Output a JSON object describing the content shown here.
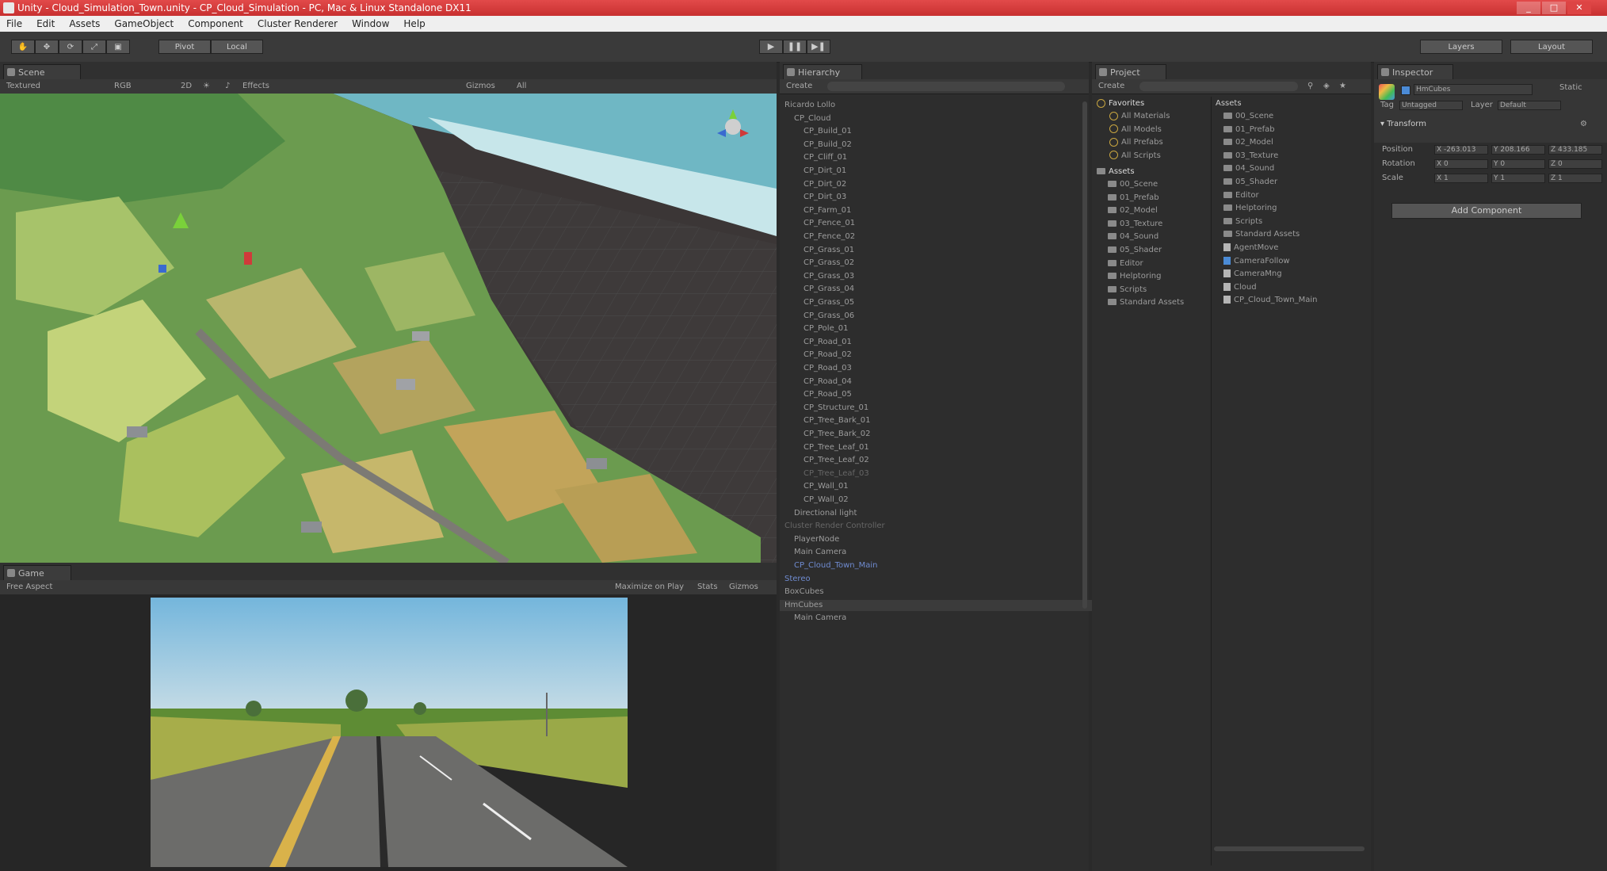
{
  "window": {
    "title": "Unity - Cloud_Simulation_Town.unity - CP_Cloud_Simulation - PC, Mac & Linux Standalone DX11"
  },
  "menubar": [
    "File",
    "Edit",
    "Assets",
    "GameObject",
    "Component",
    "Cluster Renderer",
    "Window",
    "Help"
  ],
  "toolbar": {
    "pivot": "Pivot",
    "space": "Local",
    "layers": "Layers",
    "layout": "Layout"
  },
  "scene": {
    "tab": "Scene",
    "shading": "Textured",
    "mode": "RGB",
    "twod": "2D",
    "effects": "Effects",
    "gizmos": "Gizmos",
    "search": "All"
  },
  "game": {
    "tab": "Game",
    "aspect": "Free Aspect",
    "maximize": "Maximize on Play",
    "stats": "Stats",
    "gizmos": "Gizmos"
  },
  "hierarchy": {
    "tab": "Hierarchy",
    "create": "Create",
    "items": [
      {
        "label": "Ricardo Lollo",
        "indent": 0,
        "style": ""
      },
      {
        "label": "CP_Cloud",
        "indent": 1,
        "style": ""
      },
      {
        "label": "CP_Build_01",
        "indent": 2,
        "style": ""
      },
      {
        "label": "CP_Build_02",
        "indent": 2,
        "style": ""
      },
      {
        "label": "CP_Cliff_01",
        "indent": 2,
        "style": ""
      },
      {
        "label": "CP_Dirt_01",
        "indent": 2,
        "style": ""
      },
      {
        "label": "CP_Dirt_02",
        "indent": 2,
        "style": ""
      },
      {
        "label": "CP_Dirt_03",
        "indent": 2,
        "style": ""
      },
      {
        "label": "CP_Farm_01",
        "indent": 2,
        "style": ""
      },
      {
        "label": "CP_Fence_01",
        "indent": 2,
        "style": ""
      },
      {
        "label": "CP_Fence_02",
        "indent": 2,
        "style": ""
      },
      {
        "label": "CP_Grass_01",
        "indent": 2,
        "style": ""
      },
      {
        "label": "CP_Grass_02",
        "indent": 2,
        "style": ""
      },
      {
        "label": "CP_Grass_03",
        "indent": 2,
        "style": ""
      },
      {
        "label": "CP_Grass_04",
        "indent": 2,
        "style": ""
      },
      {
        "label": "CP_Grass_05",
        "indent": 2,
        "style": ""
      },
      {
        "label": "CP_Grass_06",
        "indent": 2,
        "style": ""
      },
      {
        "label": "CP_Pole_01",
        "indent": 2,
        "style": ""
      },
      {
        "label": "CP_Road_01",
        "indent": 2,
        "style": ""
      },
      {
        "label": "CP_Road_02",
        "indent": 2,
        "style": ""
      },
      {
        "label": "CP_Road_03",
        "indent": 2,
        "style": ""
      },
      {
        "label": "CP_Road_04",
        "indent": 2,
        "style": ""
      },
      {
        "label": "CP_Road_05",
        "indent": 2,
        "style": ""
      },
      {
        "label": "CP_Structure_01",
        "indent": 2,
        "style": ""
      },
      {
        "label": "CP_Tree_Bark_01",
        "indent": 2,
        "style": ""
      },
      {
        "label": "CP_Tree_Bark_02",
        "indent": 2,
        "style": ""
      },
      {
        "label": "CP_Tree_Leaf_01",
        "indent": 2,
        "style": ""
      },
      {
        "label": "CP_Tree_Leaf_02",
        "indent": 2,
        "style": ""
      },
      {
        "label": "CP_Tree_Leaf_03",
        "indent": 2,
        "style": "dim"
      },
      {
        "label": "CP_Wall_01",
        "indent": 2,
        "style": ""
      },
      {
        "label": "CP_Wall_02",
        "indent": 2,
        "style": ""
      },
      {
        "label": "Directional light",
        "indent": 1,
        "style": ""
      },
      {
        "label": "Cluster Render Controller",
        "indent": 0,
        "style": "dim"
      },
      {
        "label": "PlayerNode",
        "indent": 1,
        "style": ""
      },
      {
        "label": "Main Camera",
        "indent": 1,
        "style": ""
      },
      {
        "label": "CP_Cloud_Town_Main",
        "indent": 1,
        "style": "blue"
      },
      {
        "label": "Stereo",
        "indent": 0,
        "style": "blue"
      },
      {
        "label": "BoxCubes",
        "indent": 0,
        "style": ""
      },
      {
        "label": "HmCubes",
        "indent": 0,
        "style": "sel"
      },
      {
        "label": "Main Camera",
        "indent": 1,
        "style": ""
      }
    ]
  },
  "project": {
    "tab": "Project",
    "create": "Create",
    "favorites_header": "Favorites",
    "favorites": [
      "All Materials",
      "All Models",
      "All Prefabs",
      "All Scripts"
    ],
    "assets_header": "Assets",
    "tree": [
      "00_Scene",
      "01_Prefab",
      "02_Model",
      "03_Texture",
      "04_Sound",
      "05_Shader",
      "Editor",
      "Helptoring",
      "Scripts",
      "Standard Assets"
    ],
    "grid_header": "Assets",
    "grid": [
      {
        "label": "00_Scene",
        "icon": "folder"
      },
      {
        "label": "01_Prefab",
        "icon": "folder"
      },
      {
        "label": "02_Model",
        "icon": "folder"
      },
      {
        "label": "03_Texture",
        "icon": "folder"
      },
      {
        "label": "04_Sound",
        "icon": "folder"
      },
      {
        "label": "05_Shader",
        "icon": "folder"
      },
      {
        "label": "Editor",
        "icon": "folder"
      },
      {
        "label": "Helptoring",
        "icon": "folder"
      },
      {
        "label": "Scripts",
        "icon": "folder"
      },
      {
        "label": "Standard Assets",
        "icon": "folder"
      },
      {
        "label": "AgentMove",
        "icon": "file"
      },
      {
        "label": "CameraFollow",
        "icon": "file-blue"
      },
      {
        "label": "CameraMng",
        "icon": "file"
      },
      {
        "label": "Cloud",
        "icon": "file"
      },
      {
        "label": "CP_Cloud_Town_Main",
        "icon": "file"
      }
    ]
  },
  "inspector": {
    "tab": "Inspector",
    "object_name": "HmCubes",
    "static": "Static",
    "tag": "Untagged",
    "layer": "Default",
    "tag_label": "Tag",
    "layer_label": "Layer",
    "component": "Transform",
    "rows": [
      {
        "label": "Position",
        "x": "X -263.013",
        "y": "Y 208.166",
        "z": "Z 433.185"
      },
      {
        "label": "Rotation",
        "x": "X 0",
        "y": "Y 0",
        "z": "Z 0"
      },
      {
        "label": "Scale",
        "x": "X 1",
        "y": "Y 1",
        "z": "Z 1"
      }
    ],
    "add_component": "Add Component"
  },
  "colors": {
    "title_bar": "#d43c3c",
    "panel": "#2d2d2d",
    "selection_blue": "#6f8bd0"
  }
}
